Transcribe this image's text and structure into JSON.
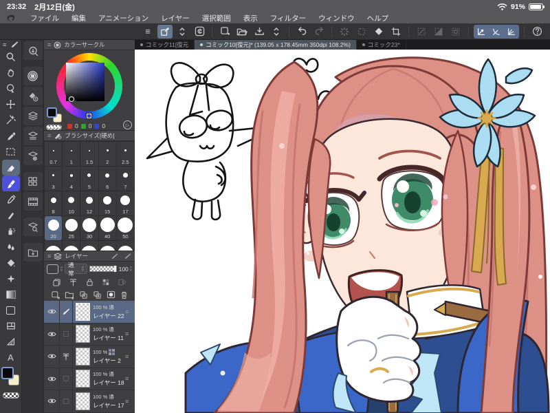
{
  "status": {
    "time": "23:32",
    "date": "2月12日(金)",
    "battery_percent": "91%"
  },
  "menubar": {
    "items": [
      "ファイル",
      "編集",
      "アニメーション",
      "レイヤー",
      "選択範囲",
      "表示",
      "フィルター",
      "ウィンドウ",
      "ヘルプ"
    ]
  },
  "toolbar": {
    "help_label": "?"
  },
  "tabs": [
    {
      "label": "コミック11[復元"
    },
    {
      "label": "コミック10[復元]* (139.05 x 178.45mm 350dpi 108.2%)",
      "active": true
    },
    {
      "label": "コミック23*"
    }
  ],
  "color_panel": {
    "title": "カラーサークル",
    "rgb": {
      "r": "0",
      "g": "0",
      "b": "0"
    }
  },
  "brush_panel": {
    "title": "ブラシサイズ[硬め]",
    "sizes": [
      "0.7",
      "1",
      "1.5",
      "2",
      "2.5",
      "3",
      "4",
      "5",
      "6",
      "7",
      "8",
      "10",
      "12",
      "15",
      "17",
      "20",
      "25",
      "30",
      "40",
      "50"
    ],
    "selected_size": "20"
  },
  "layer_panel": {
    "title": "レイヤー",
    "blend_mode": "通常",
    "opacity_value": "100",
    "layers": [
      {
        "opacity": "100 %",
        "blend": "通",
        "name": "レイヤー 22",
        "selected": true
      },
      {
        "opacity": "100 %",
        "blend": "通",
        "name": "レイヤー 11"
      },
      {
        "opacity": "100 %",
        "blend": "",
        "name": "レイヤー 2"
      },
      {
        "opacity": "100 %",
        "blend": "通",
        "name": "レイヤー 18"
      },
      {
        "opacity": "100 %",
        "blend": "通",
        "name": "レイヤー 17"
      }
    ]
  },
  "palette": {
    "ui_chrome": "#58585b",
    "ui_panel": "#3f3f42",
    "ui_selection": "#5a6a86",
    "ui_tool_selected": "#4d50d8",
    "hair_base": "#dd9186",
    "hair_light": "#f0b3a8",
    "hair_shadow": "#c4706b",
    "hair_line": "#7c3a38",
    "skin": "#fde6da",
    "skin_shadow": "#f3c4b5",
    "eye_green": "#3f8a68",
    "eye_dark": "#17412f",
    "eye_light": "#8ed9b4",
    "jacket_blue": "#3a67c8",
    "jacket_navy": "#2d4f92",
    "jacket_dark": "#27406e",
    "gold": "#d9a94f",
    "strap_brown": "#9a6a40",
    "flower_blue": "#aadcf2",
    "frill_blue": "#bfe6f7",
    "mouth_red": "#b4524e",
    "line_dark": "#2e2630"
  }
}
